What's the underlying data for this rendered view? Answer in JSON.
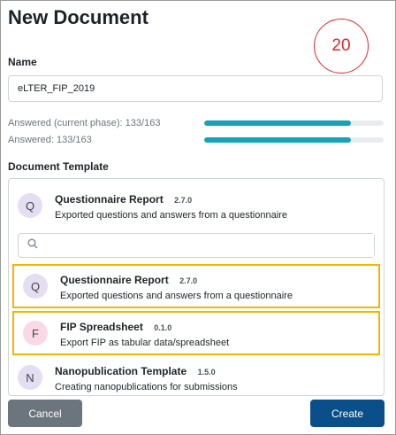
{
  "dialog": {
    "title": "New Document",
    "badge": "20",
    "name_label": "Name",
    "name_value": "eLTER_FIP_2019"
  },
  "progress": [
    {
      "label": "Answered (current phase): 133/163",
      "fraction": 0.816
    },
    {
      "label": "Answered: 133/163",
      "fraction": 0.816
    }
  ],
  "template": {
    "label": "Document Template",
    "selected": {
      "initial": "Q",
      "title": "Questionnaire Report",
      "version": "2.7.0",
      "description": "Exported questions and answers from a questionnaire",
      "color": "#e4def3"
    },
    "search_placeholder": "",
    "options": [
      {
        "initial": "Q",
        "title": "Questionnaire Report",
        "version": "2.7.0",
        "description": "Exported questions and answers from a questionnaire",
        "color": "#e4def3"
      },
      {
        "initial": "F",
        "title": "FIP Spreadsheet",
        "version": "0.1.0",
        "description": "Export FIP as tabular data/spreadsheet",
        "color": "#fbd8e6"
      },
      {
        "initial": "N",
        "title": "Nanopublication Template",
        "version": "1.5.0",
        "description": "Creating nanopublications for submissions",
        "color": "#e4def3"
      }
    ]
  },
  "buttons": {
    "cancel": "Cancel",
    "create": "Create"
  },
  "colors": {
    "accent": "#17a2b8",
    "primary": "#0b4f8a",
    "highlight": "#f2b600",
    "badge": "#e0262e"
  }
}
